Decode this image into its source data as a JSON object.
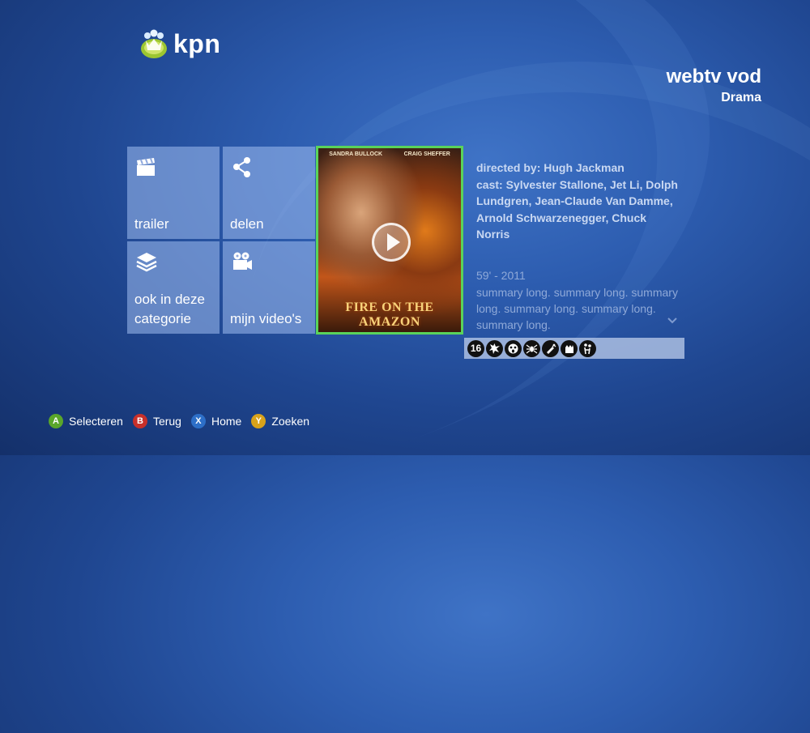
{
  "brand": {
    "name": "kpn"
  },
  "header": {
    "title": "webtv vod",
    "subtitle": "Drama"
  },
  "tiles": [
    {
      "label": "trailer",
      "icon": "clapperboard-icon"
    },
    {
      "label": "delen",
      "icon": "share-icon"
    },
    {
      "label": "ook in deze categorie",
      "icon": "layers-icon"
    },
    {
      "label": "mijn video's",
      "icon": "video-camera-icon"
    }
  ],
  "poster": {
    "credits": [
      "SANDRA BULLOCK",
      "CRAIG SHEFFER"
    ],
    "title": "FIRE ON THE AMAZON",
    "selected_color": "#5ad35a"
  },
  "details": {
    "director": "directed by: Hugh Jackman",
    "cast": "cast: Sylvester Stallone, Jet Li, Dolph Lundgren, Jean-Claude Van Damme, Arnold Schwarzenegger, Chuck Norris",
    "meta": "59' -  2011",
    "summary": "summary long. summary long. summary long. summary long. summary long. summary long."
  },
  "ratings": {
    "age": "16",
    "icons": [
      "violence-icon",
      "fear-icon",
      "spider-icon",
      "drugs-icon",
      "discrimination-icon",
      "sex-icon"
    ]
  },
  "footer": [
    {
      "key": "A",
      "label": "Selecteren",
      "color": "#5aa62a"
    },
    {
      "key": "B",
      "label": "Terug",
      "color": "#c8302a"
    },
    {
      "key": "X",
      "label": "Home",
      "color": "#2d6fc8"
    },
    {
      "key": "Y",
      "label": "Zoeken",
      "color": "#d8a21a"
    }
  ]
}
